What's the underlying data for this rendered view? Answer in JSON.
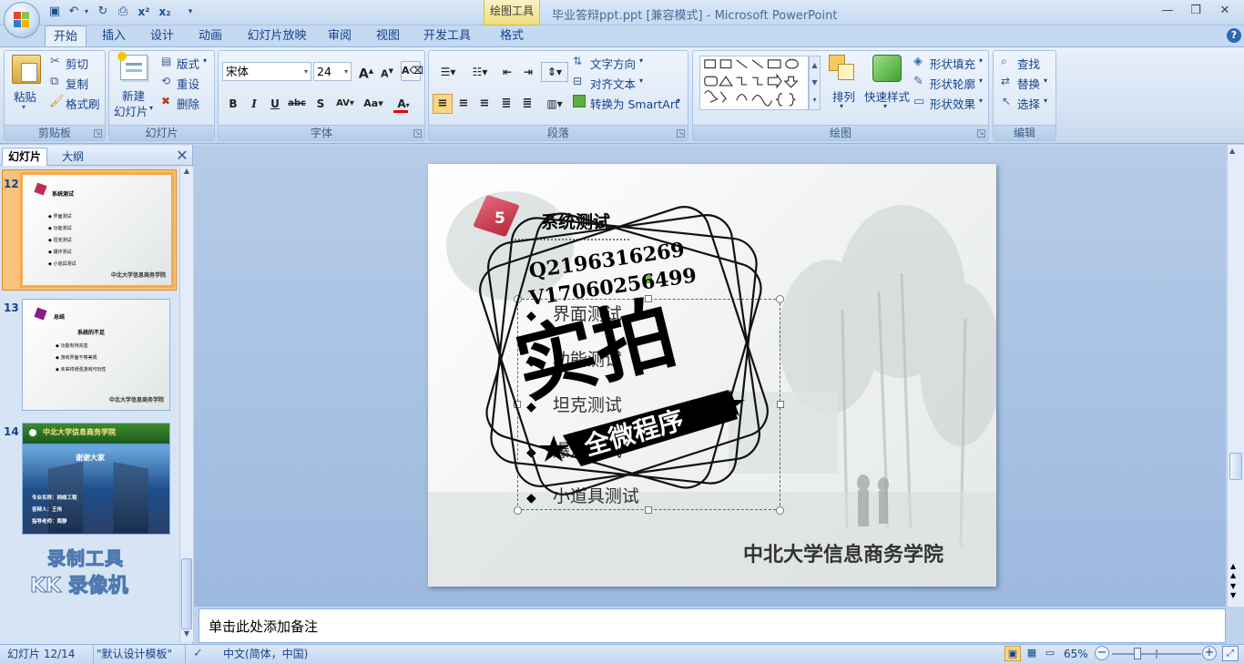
{
  "titlebar": {
    "title": "毕业答辩ppt.ppt [兼容模式] - Microsoft PowerPoint",
    "context_group": "绘图工具"
  },
  "tabs": [
    "开始",
    "插入",
    "设计",
    "动画",
    "幻灯片放映",
    "审阅",
    "视图",
    "开发工具",
    "格式"
  ],
  "ribbon": {
    "clipboard": {
      "label": "剪贴板",
      "paste": "粘贴",
      "cut": "剪切",
      "copy": "复制",
      "format_painter": "格式刷"
    },
    "slides": {
      "label": "幻灯片",
      "new_slide_1": "新建",
      "new_slide_2": "幻灯片",
      "layout": "版式",
      "reset": "重设",
      "delete": "删除"
    },
    "font": {
      "label": "字体",
      "font_name": "宋体",
      "font_size": "24"
    },
    "paragraph": {
      "label": "段落",
      "text_direction": "文字方向",
      "align_text": "对齐文本",
      "smartart": "转换为 SmartArt"
    },
    "drawing": {
      "label": "绘图",
      "arrange": "排列",
      "quick_styles": "快速样式",
      "shape_fill": "形状填充",
      "shape_outline": "形状轮廓",
      "shape_effects": "形状效果"
    },
    "editing": {
      "label": "编辑",
      "find": "查找",
      "replace": "替换",
      "select": "选择"
    }
  },
  "left_pane": {
    "tab_slides": "幻灯片",
    "tab_outline": "大纲",
    "thumbnails": [
      {
        "number": "12",
        "title": "系统测试",
        "items": [
          "界面测试",
          "功能测试",
          "坦克测试",
          "爆炸测试",
          "小道具测试"
        ],
        "footer": "中北大学信息商务学院"
      },
      {
        "number": "13",
        "title": "总结",
        "subtitle": "系统的不足",
        "items": [
          "功能有待完善",
          "游戏界面不够美观",
          "未来将增强游戏可玩性"
        ],
        "footer": "中北大学信息商务学院"
      },
      {
        "number": "14",
        "title": "中北大学信息商务学院",
        "subtitle": "谢谢大家",
        "items": [
          "专业名称：网络工程",
          "答辩人：王伟",
          "指导老师：周静"
        ]
      }
    ],
    "watermark_line1": "录制工具",
    "watermark_line2": "KK 录像机"
  },
  "slide": {
    "number_badge": "5",
    "title": "系统测试",
    "bullets": [
      "界面测试",
      "功能测试",
      "坦克测试",
      "爆炸测试",
      "小道具测试"
    ],
    "footer": "中北大学信息商务学院",
    "watermark": {
      "q": "Q2196316269",
      "v": "V17060256499",
      "big": "实拍",
      "banner": "全微程序"
    }
  },
  "notes_placeholder": "单击此处添加备注",
  "statusbar": {
    "slide_index": "幻灯片 12/14",
    "theme": "\"默认设计模板\"",
    "language": "中文(简体，中国)",
    "zoom": "65%"
  }
}
